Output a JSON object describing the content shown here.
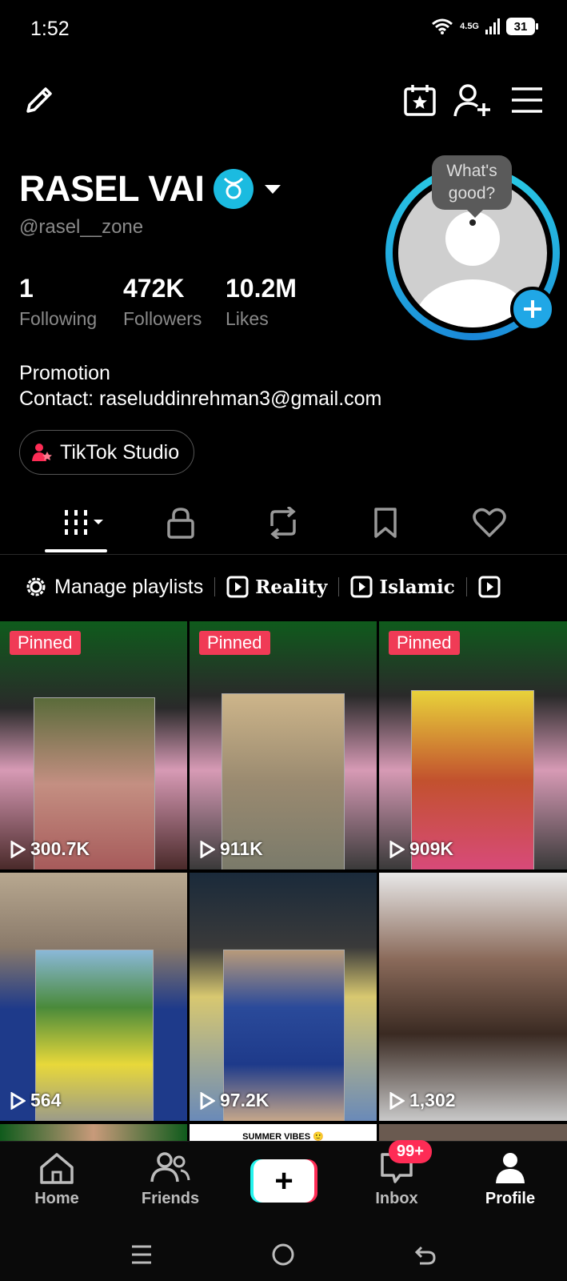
{
  "status": {
    "time": "1:52",
    "network": "4.5G",
    "battery": "31"
  },
  "profile": {
    "name": "RASEL VAI",
    "handle": "@rasel__zone",
    "stats": [
      {
        "num": "1",
        "label": "Following"
      },
      {
        "num": "472K",
        "label": "Followers"
      },
      {
        "num": "10.2M",
        "label": "Likes"
      }
    ],
    "bio_line1": "Promotion",
    "bio_line2": "Contact: raseluddinrehman3@gmail.com",
    "studio_label": "TikTok Studio",
    "bubble_line1": "What's",
    "bubble_line2": "good?"
  },
  "playlists": {
    "manage": "Manage playlists",
    "items": [
      "Reality",
      "Islamic"
    ]
  },
  "videos": [
    {
      "pinned": "Pinned",
      "views": "300.7K"
    },
    {
      "pinned": "Pinned",
      "views": "911K"
    },
    {
      "pinned": "Pinned",
      "views": "909K"
    },
    {
      "pinned": "",
      "views": "564"
    },
    {
      "pinned": "",
      "views": "97.2K"
    },
    {
      "pinned": "",
      "views": "1,302"
    }
  ],
  "peek_text": "SUMMER VIBES 🙂",
  "nav": {
    "home": "Home",
    "friends": "Friends",
    "inbox": "Inbox",
    "inbox_badge": "99+",
    "profile": "Profile"
  }
}
